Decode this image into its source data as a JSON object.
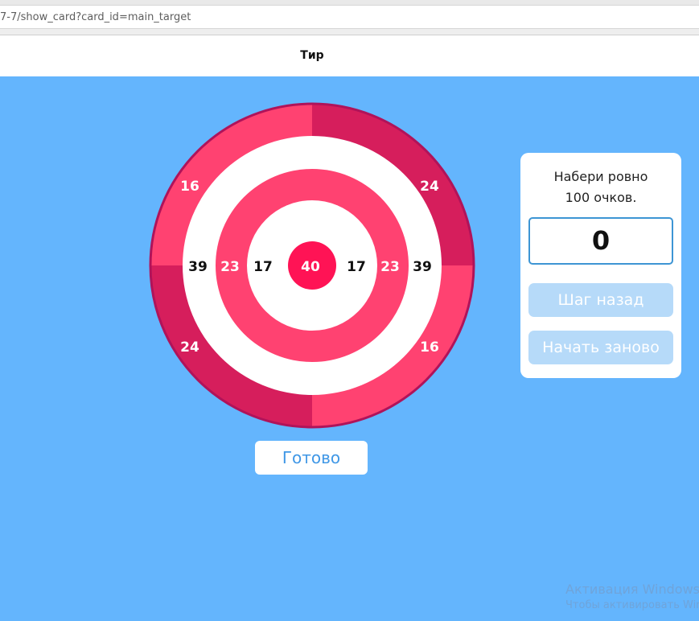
{
  "browser": {
    "url": "7-7/show_card?card_id=main_target"
  },
  "page": {
    "title": "Тир"
  },
  "target": {
    "colors": {
      "pink": "#ff4271",
      "dark_pink": "#d61e5c",
      "bullseye": "#ff1355",
      "white": "#ffffff",
      "border": "#b0135a"
    },
    "labels": {
      "outer_top_left": "16",
      "outer_top_right": "24",
      "outer_bottom_left": "24",
      "outer_bottom_right": "16",
      "white_left": "39",
      "white_right": "39",
      "pink_left": "23",
      "pink_right": "23",
      "inner_white_left": "17",
      "inner_white_right": "17",
      "bullseye": "40"
    }
  },
  "done_button": {
    "label": "Готово"
  },
  "panel": {
    "task_line1": "Набери ровно",
    "task_line2": "100 очков.",
    "score": "0",
    "back_label": "Шаг назад",
    "restart_label": "Начать заново"
  },
  "watermark": {
    "line1": "Активация Windows",
    "line2": "Чтобы активировать Windows"
  }
}
